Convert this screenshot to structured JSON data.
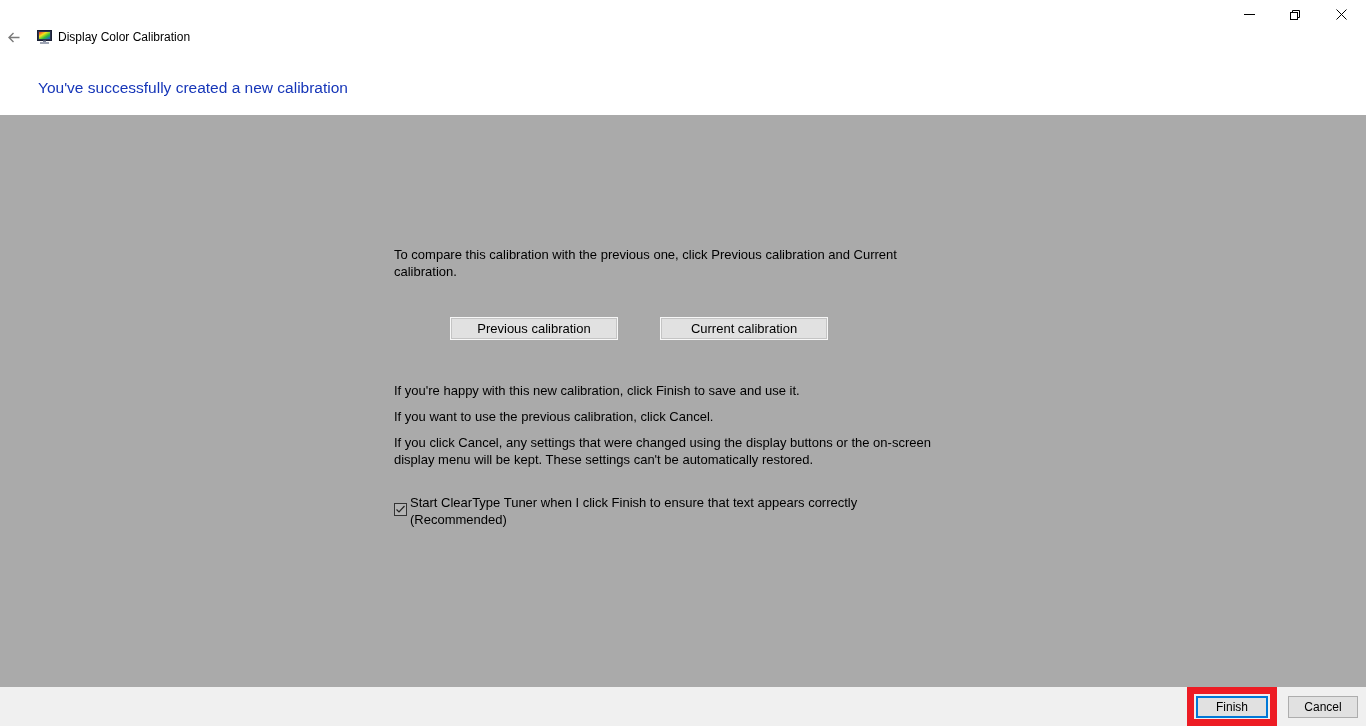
{
  "window": {
    "title": "Display Color Calibration"
  },
  "heading": "You've successfully created a new calibration",
  "content": {
    "intro": "To compare this calibration with the previous one, click Previous calibration and Current calibration.",
    "compare_buttons": [
      {
        "label": "Previous calibration"
      },
      {
        "label": "Current calibration"
      }
    ],
    "notes": [
      "If you're happy with this new calibration, click Finish to save and use it.",
      "If you want to use the previous calibration, click Cancel.",
      "If you click Cancel, any settings that were changed using the display buttons or the on-screen display menu will be kept. These settings can't be automatically restored."
    ],
    "option": {
      "label": "Start ClearType Tuner when I click Finish to ensure that text appears correctly (Recommended)",
      "checked": true
    }
  },
  "footer": {
    "buttons": [
      {
        "label": "Finish",
        "default": true,
        "highlighted": true
      },
      {
        "label": "Cancel",
        "default": false,
        "highlighted": false
      }
    ]
  }
}
